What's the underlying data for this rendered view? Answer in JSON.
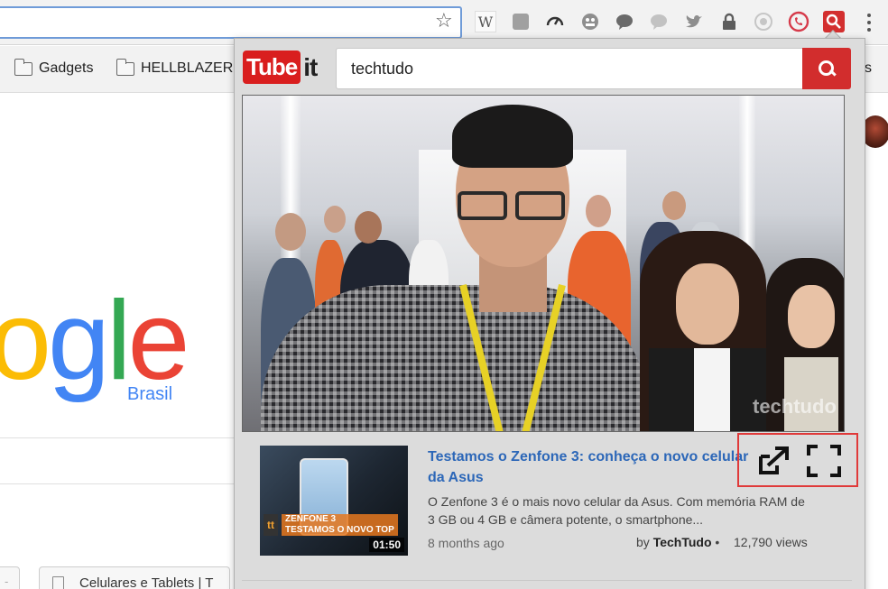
{
  "toolbar": {
    "extensions": [
      {
        "name": "wikipedia-icon",
        "glyph": "W"
      },
      {
        "name": "pin-extension-icon",
        "glyph": "✎"
      },
      {
        "name": "speed-gauge-icon",
        "glyph": "◔"
      },
      {
        "name": "ghost-extension-icon",
        "glyph": "☺"
      },
      {
        "name": "chat-bubble-icon",
        "glyph": "●"
      },
      {
        "name": "comment-icon",
        "glyph": "💬"
      },
      {
        "name": "twitter-bird-icon",
        "glyph": "🐦"
      },
      {
        "name": "lock-icon",
        "glyph": "🔒"
      },
      {
        "name": "circle-extension-icon",
        "glyph": "◎"
      },
      {
        "name": "whatsapp-icon",
        "glyph": "✆"
      },
      {
        "name": "tubeit-search-icon",
        "glyph": "⌕"
      }
    ]
  },
  "bookmarks": {
    "items": [
      "Gadgets",
      "HELLBLAZER"
    ],
    "overflow_tail": "s"
  },
  "google": {
    "logo_letters": [
      "o",
      "g",
      "l",
      "e"
    ],
    "logo_colors": [
      "#fbbc05",
      "#4285f4",
      "#34a853",
      "#ea4335"
    ],
    "country": "Brasil"
  },
  "tabs": {
    "tab1_text": "- C",
    "tab2_text": "Celulares e Tablets | T"
  },
  "popup": {
    "logo_tube": "Tube",
    "logo_it": "it",
    "search_value": "techtudo",
    "video": {
      "watermark": "techtudo"
    },
    "result": {
      "title": "Testamos o Zenfone 3: conheça o novo celular da Asus",
      "description": "O Zenfone 3 é o mais novo celular da Asus. Com memória RAM de 3 GB ou 4 GB e câmera potente, o smartphone...",
      "age": "8 months ago",
      "by_prefix": "by ",
      "channel": "TechTudo",
      "separator": "•",
      "views": "12,790 views",
      "thumb_brand": "tt",
      "thumb_label_1": "ZENFONE 3",
      "thumb_label_2": "TESTAMOS O NOVO TOP",
      "duration": "01:50"
    },
    "colors": {
      "accent": "#d22d2d",
      "link": "#2c67b8",
      "highlight_border": "#e03a3a"
    }
  }
}
